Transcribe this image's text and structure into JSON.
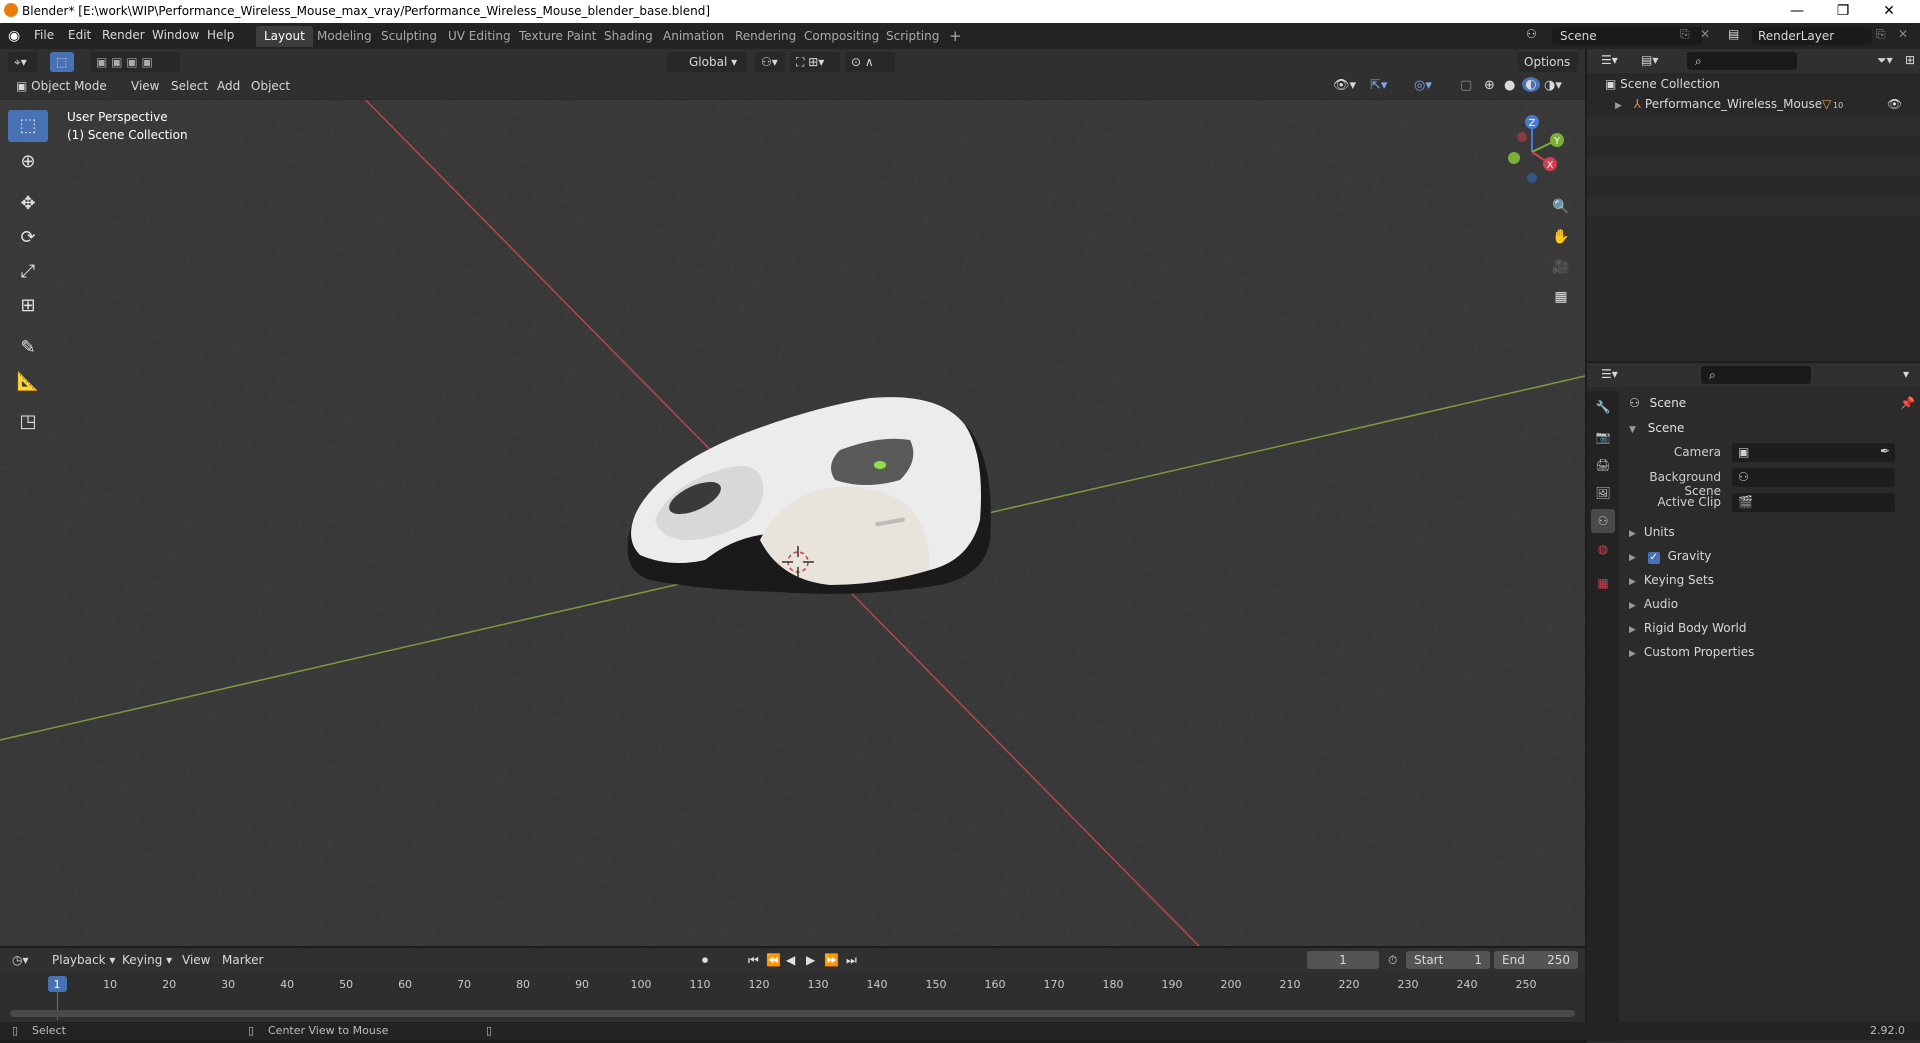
{
  "window": {
    "title": "Blender* [E:\\work\\WIP\\Performance_Wireless_Mouse_max_vray/Performance_Wireless_Mouse_blender_base.blend]",
    "controls": {
      "minimize": "—",
      "maximize": "❐",
      "close": "✕"
    }
  },
  "menu": [
    "File",
    "Edit",
    "Render",
    "Window",
    "Help"
  ],
  "workspaces": [
    "Layout",
    "Modeling",
    "Sculpting",
    "UV Editing",
    "Texture Paint",
    "Shading",
    "Animation",
    "Rendering",
    "Compositing",
    "Scripting"
  ],
  "workspace_add": "+",
  "scene_name": "Scene",
  "render_layer": "RenderLayer",
  "viewport_header": {
    "transform": "Global",
    "options": "Options",
    "mode": "Object Mode",
    "menus": [
      "View",
      "Select",
      "Add",
      "Object"
    ]
  },
  "viewport": {
    "perspective": "User Perspective",
    "collection": "(1) Scene Collection",
    "axes": {
      "z": "Z",
      "y": "Y",
      "x": "X"
    }
  },
  "outliner": {
    "root": "Scene Collection",
    "items": [
      {
        "name": "Performance_Wireless_Mouse",
        "count": "10"
      }
    ]
  },
  "properties": {
    "context": "Scene",
    "section": "Scene",
    "fields": [
      {
        "label": "Camera",
        "value": ""
      },
      {
        "label": "Background Scene",
        "value": ""
      },
      {
        "label": "Active Clip",
        "value": ""
      }
    ],
    "panels": [
      {
        "label": "Units",
        "checkbox": false
      },
      {
        "label": "Gravity",
        "checkbox": true
      },
      {
        "label": "Keying Sets",
        "checkbox": false
      },
      {
        "label": "Audio",
        "checkbox": false
      },
      {
        "label": "Rigid Body World",
        "checkbox": false
      },
      {
        "label": "Custom Properties",
        "checkbox": false
      }
    ]
  },
  "timeline": {
    "menus": [
      "Playback",
      "Keying",
      "View",
      "Marker"
    ],
    "current_frame": "1",
    "start_label": "Start",
    "start": "1",
    "end_label": "End",
    "end": "250",
    "ticks": [
      "1",
      "10",
      "20",
      "30",
      "40",
      "50",
      "60",
      "70",
      "80",
      "90",
      "100",
      "110",
      "120",
      "130",
      "140",
      "150",
      "160",
      "170",
      "180",
      "190",
      "200",
      "210",
      "220",
      "230",
      "240",
      "250"
    ]
  },
  "statusbar": {
    "left": "Select",
    "middle": "Center View to Mouse",
    "version": "2.92.0"
  }
}
